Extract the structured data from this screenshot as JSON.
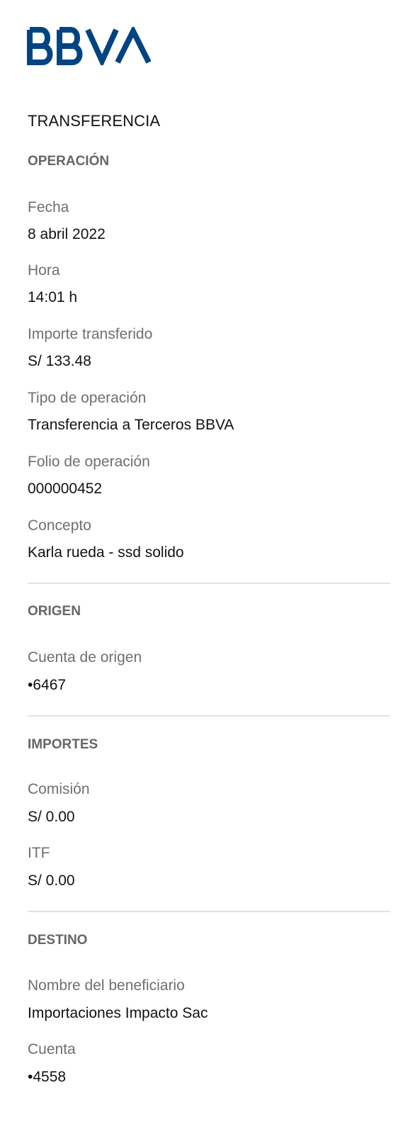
{
  "brand": {
    "logo_text": "BBVA",
    "color": "#004481"
  },
  "title": "TRANSFERENCIA",
  "operacion": {
    "heading": "OPERACIÓN",
    "fecha_label": "Fecha",
    "fecha_value": "8 abril 2022",
    "hora_label": "Hora",
    "hora_value": "14:01 h",
    "importe_label": "Importe transferido",
    "importe_value": "S/ 133.48",
    "tipo_label": "Tipo de operación",
    "tipo_value": "Transferencia a Terceros BBVA",
    "folio_label": "Folio de operación",
    "folio_value": "000000452",
    "concepto_label": "Concepto",
    "concepto_value": "Karla rueda - ssd solido"
  },
  "origen": {
    "heading": "ORIGEN",
    "cuenta_label": "Cuenta de origen",
    "cuenta_value": "•6467"
  },
  "importes": {
    "heading": "IMPORTES",
    "comision_label": "Comisión",
    "comision_value": "S/ 0.00",
    "itf_label": "ITF",
    "itf_value": "S/ 0.00"
  },
  "destino": {
    "heading": "DESTINO",
    "beneficiario_label": "Nombre del beneficiario",
    "beneficiario_value": "Importaciones Impacto Sac",
    "cuenta_label": "Cuenta",
    "cuenta_value": "•4558"
  }
}
